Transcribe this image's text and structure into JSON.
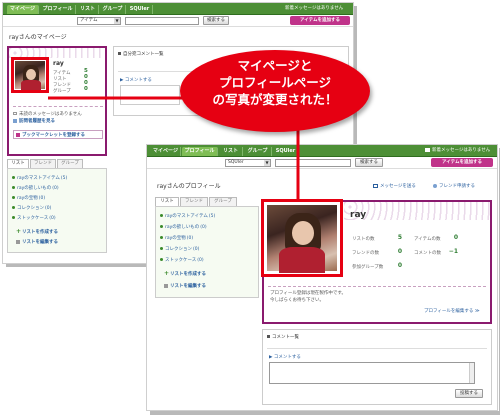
{
  "mypage": {
    "nav": {
      "tabs": [
        "マイページ",
        "プロフィール",
        "リスト",
        "グループ",
        "SQUler"
      ],
      "notice": "新着メッセージはありません"
    },
    "search": {
      "select_value": "アイテム",
      "button": "検索する",
      "post_button": "アイテムを追加する"
    },
    "page_title": "rayさんのマイページ",
    "profile": {
      "name": "ray",
      "stat_labels": [
        "アイテム",
        "リスト",
        "フレンド",
        "グループ"
      ],
      "stat_values": [
        "5",
        "0",
        "0",
        "0"
      ]
    },
    "messages": {
      "unread": "未読のメッセージはありません",
      "history": "訪問者履歴を見る",
      "bookmark": "ブックマークレットを登録する"
    },
    "comments": {
      "title": "自分宛コメント一覧",
      "write": "コメントする"
    },
    "list_tabs": [
      "リスト",
      "フレンド",
      "グループ"
    ],
    "list_items": [
      "rayのマストアイテム",
      "rayの欲しいもの",
      "rayの宝物",
      "コレクション",
      "ストックケース"
    ],
    "list_counts": [
      "(5)",
      "(0)",
      "(0)",
      "(0)",
      "(0)"
    ],
    "actions": {
      "create": "リストを作成する",
      "edit": "リストを編集する"
    }
  },
  "profile_page": {
    "nav": {
      "tabs": [
        "マイページ",
        "プロフィール",
        "リスト",
        "グループ",
        "SQUler"
      ],
      "notice": "新着メッセージはありません"
    },
    "search": {
      "select_value": "SQUler",
      "button": "検索する",
      "post_button": "アイテムを追加する"
    },
    "page_title": "rayさんのプロフィール",
    "header_links": {
      "message": "メッセージを送る",
      "friend": "フレンド申請する"
    },
    "profile": {
      "name": "ray",
      "stats": [
        {
          "label": "リストの数",
          "value": "5"
        },
        {
          "label": "アイテムの数",
          "value": "0"
        },
        {
          "label": "フレンドの数",
          "value": "0"
        },
        {
          "label": "コメントの数",
          "value": "−1"
        },
        {
          "label": "参加グループ数",
          "value": "0"
        }
      ],
      "intro_line1": "プロフィール登録は現在製作中です。",
      "intro_line2": "今しばらくお待ち下さい。",
      "edit_link": "プロフィールを編集する ≫"
    },
    "list_tabs": [
      "リスト",
      "フレンド",
      "グループ"
    ],
    "list_items": [
      "rayのマストアイテム",
      "rayの欲しいもの",
      "rayの宝物",
      "コレクション",
      "ストックケース"
    ],
    "list_counts": [
      "(5)",
      "(0)",
      "(0)",
      "(0)",
      "(0)"
    ],
    "actions": {
      "create": "リストを作成する",
      "edit": "リストを編集する"
    },
    "comments": {
      "title": "コメント一覧",
      "write": "コメントする",
      "submit": "投稿する"
    }
  },
  "callout": {
    "line1": "マイページと",
    "line2": "プロフィールページ",
    "line3": "の写真が変更された！"
  },
  "colors": {
    "nav_green": "#4d8f36",
    "accent_magenta": "#c0338a",
    "highlight_red": "#e60012"
  }
}
